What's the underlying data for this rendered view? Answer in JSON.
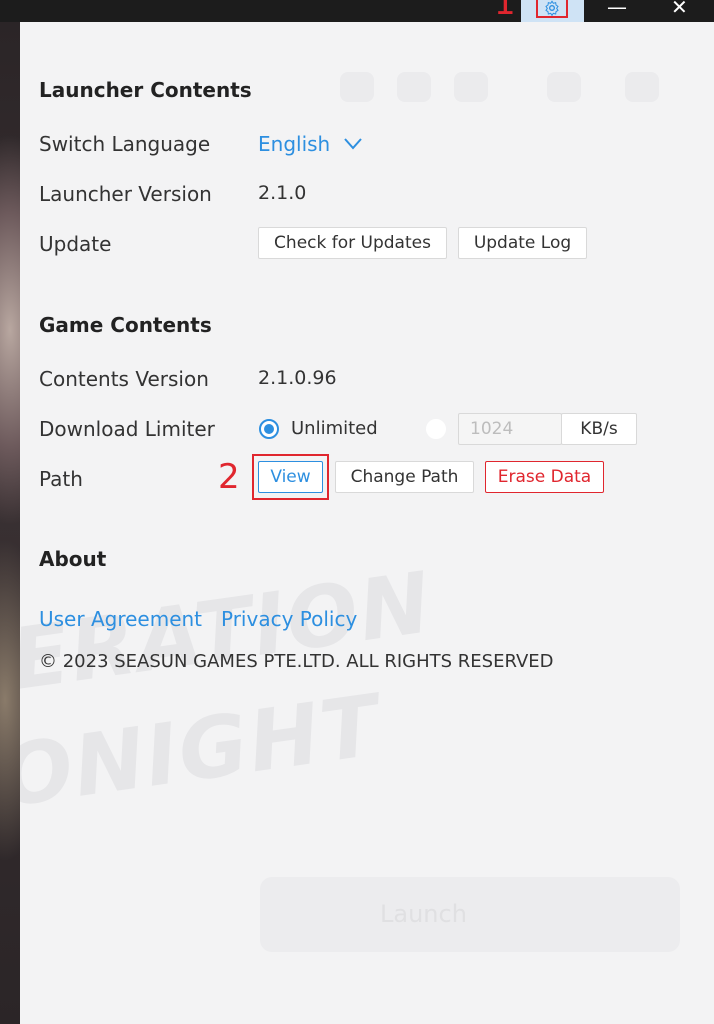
{
  "window": {
    "minimize_glyph": "—",
    "close_glyph": "✕",
    "settings_icon": "gear-icon"
  },
  "annotations": {
    "marker_1": "1",
    "marker_2": "2"
  },
  "background": {
    "launch_label": "Launch"
  },
  "launcher_contents": {
    "title": "Launcher Contents",
    "language_label": "Switch Language",
    "language_value": "English",
    "version_label": "Launcher Version",
    "version_value": "2.1.0",
    "update_label": "Update",
    "check_updates_button": "Check for Updates",
    "update_log_button": "Update Log"
  },
  "game_contents": {
    "title": "Game Contents",
    "contents_version_label": "Contents Version",
    "contents_version_value": "2.1.0.96",
    "download_limiter_label": "Download Limiter",
    "unlimited_option": "Unlimited",
    "limit_value_placeholder": "1024",
    "limit_unit": "KB/s",
    "path_label": "Path",
    "view_button": "View",
    "change_path_button": "Change Path",
    "erase_data_button": "Erase Data"
  },
  "about": {
    "title": "About",
    "user_agreement_link": "User Agreement",
    "privacy_policy_link": "Privacy Policy",
    "copyright": "© 2023 SEASUN GAMES PTE.LTD. ALL RIGHTS RESERVED"
  },
  "colors": {
    "accent": "#2d8fe0",
    "danger": "#e0262e",
    "panel_bg": "#f3f3f4"
  }
}
